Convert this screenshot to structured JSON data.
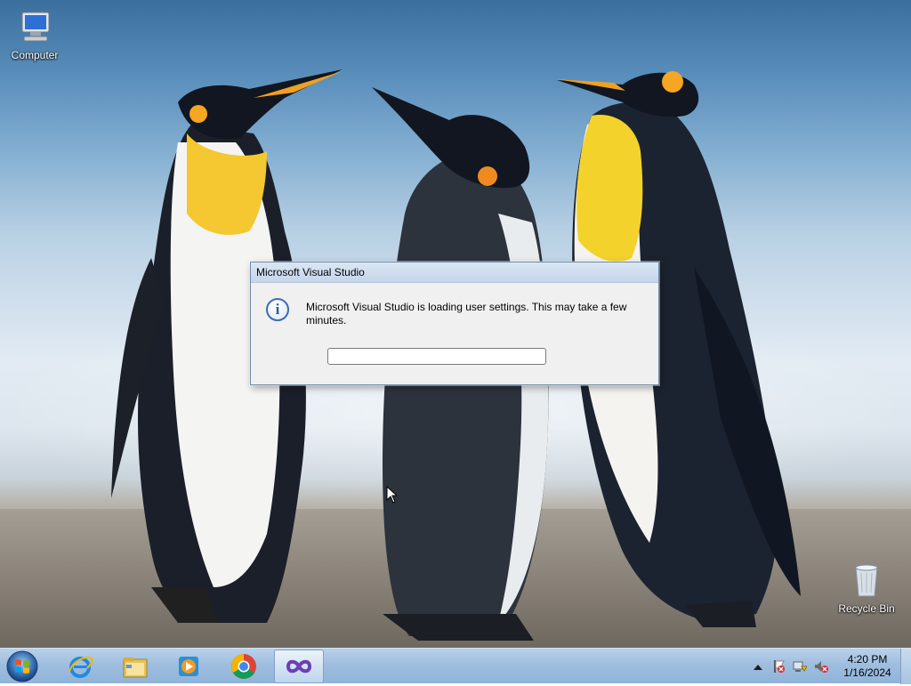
{
  "desktop": {
    "icons": [
      {
        "label": "Computer",
        "icon": "computer-icon"
      },
      {
        "label": "Recycle Bin",
        "icon": "recycle-bin-icon"
      }
    ]
  },
  "dialog": {
    "title": "Microsoft Visual Studio",
    "message": "Microsoft Visual Studio is loading user settings. This may take a few minutes.",
    "icon": "info-icon",
    "progress_percent": 0
  },
  "taskbar": {
    "start": {
      "icon": "windows-start-icon"
    },
    "apps": [
      {
        "name": "Internet Explorer",
        "icon": "internet-explorer-icon",
        "active": false
      },
      {
        "name": "Windows Explorer",
        "icon": "file-explorer-icon",
        "active": false
      },
      {
        "name": "Windows Media Player",
        "icon": "media-player-icon",
        "active": false
      },
      {
        "name": "Google Chrome",
        "icon": "chrome-icon",
        "active": false
      },
      {
        "name": "Visual Studio",
        "icon": "visual-studio-icon",
        "active": true
      }
    ],
    "tray": {
      "icons": [
        "show-hidden-icons-arrow",
        "action-center-flag-icon",
        "network-icon",
        "volume-muted-icon"
      ],
      "time": "4:20 PM",
      "date": "1/16/2024"
    }
  },
  "colors": {
    "taskbar": "#9fbedf",
    "dialog_bg": "#f0f0f0",
    "dialog_title": "#c5d6ea"
  }
}
